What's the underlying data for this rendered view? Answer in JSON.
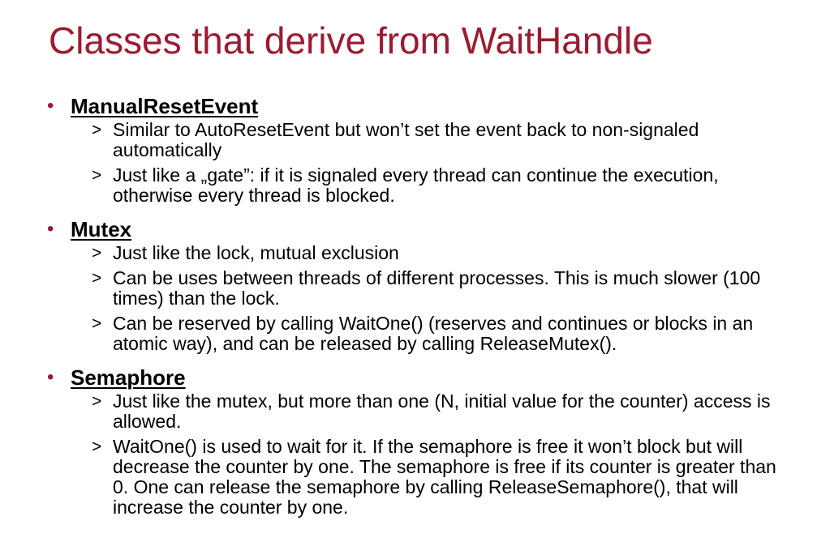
{
  "title": "Classes that derive from WaitHandle",
  "sections": [
    {
      "heading": "ManualResetEvent",
      "items": [
        "Similar to AutoResetEvent but won’t set the event back to non-signaled automatically",
        "Just like a „gate”: if it is signaled every thread can continue the execution, otherwise every thread is blocked."
      ]
    },
    {
      "heading": "Mutex",
      "items": [
        "Just like the lock, mutual exclusion",
        "Can be uses between threads of different processes. This is much slower (100 times) than the lock.",
        "Can be reserved by calling WaitOne() (reserves and continues or blocks in an atomic way), and can be released by calling ReleaseMutex()."
      ]
    },
    {
      "heading": "Semaphore",
      "items": [
        "Just like the mutex, but more than one (N, initial value for the counter) access is allowed.",
        "WaitOne() is used to wait for it. If the semaphore is free it won’t block but will decrease the counter by one. The semaphore is free if its counter is greater than 0. One can release the semaphore by calling ReleaseSemaphore(), that will increase the counter by one."
      ]
    }
  ],
  "markers": {
    "bullet": "•",
    "sub": ">"
  },
  "colors": {
    "title": "#9b1b30",
    "bullet": "#9b1b30",
    "text": "#000000"
  }
}
